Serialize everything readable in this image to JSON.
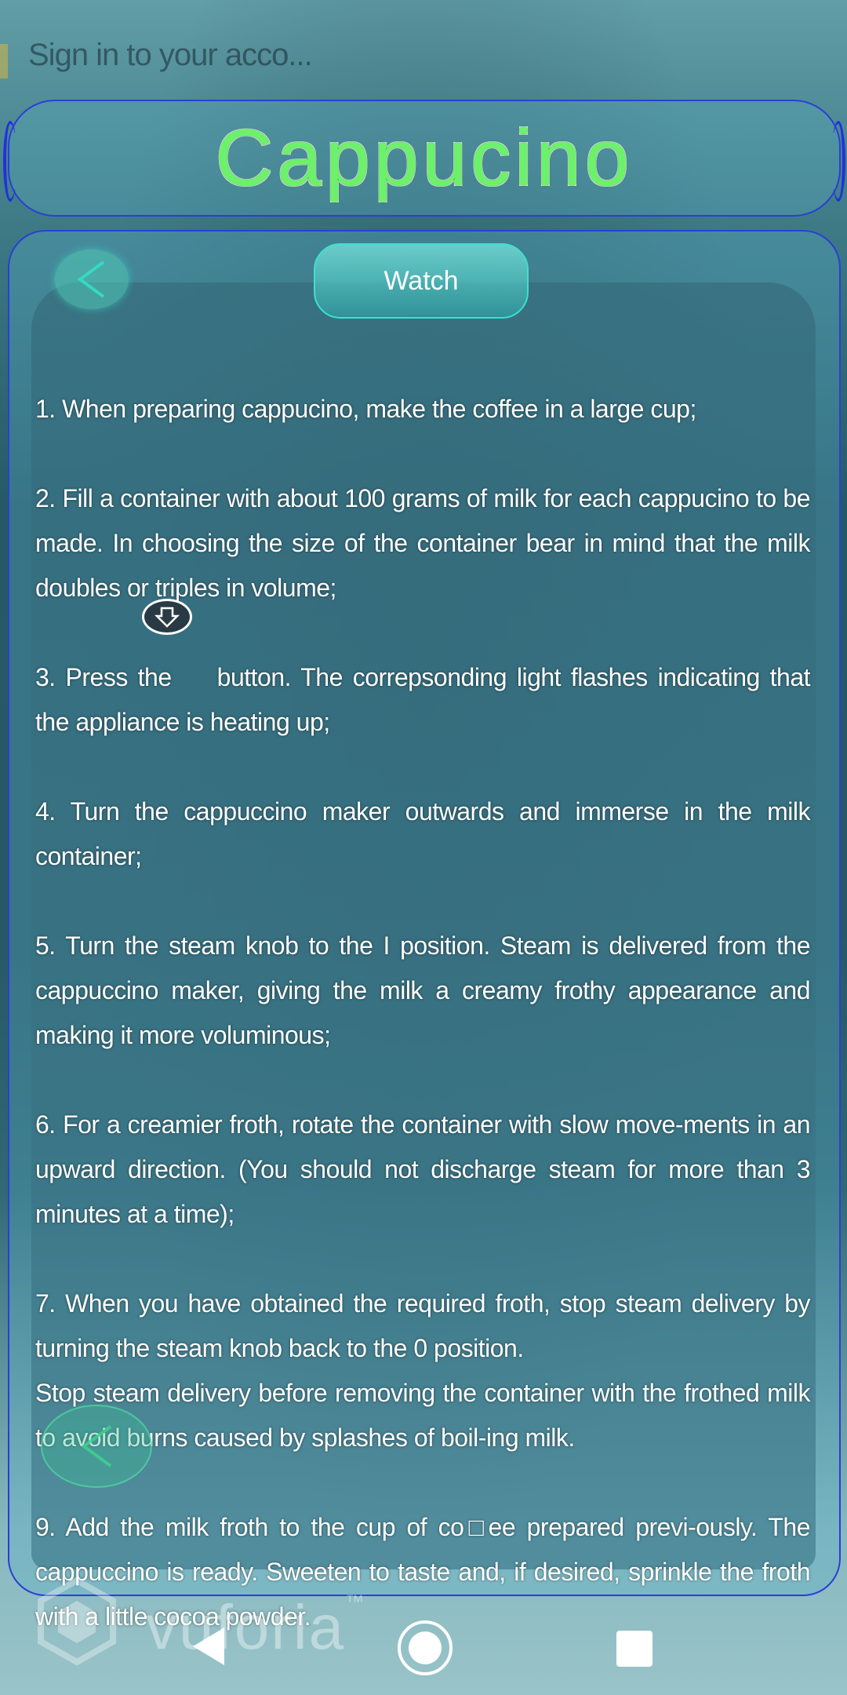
{
  "status_overlay": {
    "signin_text": "Sign in to your acco..."
  },
  "header": {
    "title": "Cappucino"
  },
  "toolbar": {
    "watch_label": "Watch"
  },
  "steps": [
    "1. When preparing cappucino, make the coffee in a large cup;",
    "2. Fill a container with about 100 grams of milk for each cappucino to be made. In choosing the size of the container bear in mind that the milk doubles or triples in volume;",
    "3. Press the",
    "button. The correpsonding light flashes indicating that the appliance is heating up;",
    "4. Turn the cappuccino maker outwards and immerse in the milk container;",
    "5.  Turn the steam knob to the I position. Steam is delivered from the cappuccino maker, giving the milk a creamy frothy appearance and making it more voluminous;",
    "6. For a creamier froth, rotate the container with slow move-ments in an upward direction. (You should not discharge steam for more than 3 minutes at a time);",
    "7. When you have obtained the required froth, stop steam delivery by turning the steam knob back to the 0 position.",
    "Stop steam delivery before removing the container with the frothed milk to avoid burns caused by splashes of boil-ing milk.",
    "9.  Add the milk froth to the cup of co□ee prepared previ-ously. The cappuccino is ready. Sweeten to taste and, if desired, sprinkle the froth with a little cocoa powder."
  ],
  "watermark": {
    "text": "vuforia",
    "tm": "™"
  },
  "icons": {
    "back": "chevron-left-icon",
    "steam": "steam-button-icon",
    "nav_back": "triangle-back-icon",
    "nav_home": "circle-home-icon",
    "nav_recents": "square-recents-icon"
  },
  "colors": {
    "title_green": "#6cf26a",
    "panel_border": "#2a3fd6",
    "watch_cyan": "#3de0d0"
  }
}
